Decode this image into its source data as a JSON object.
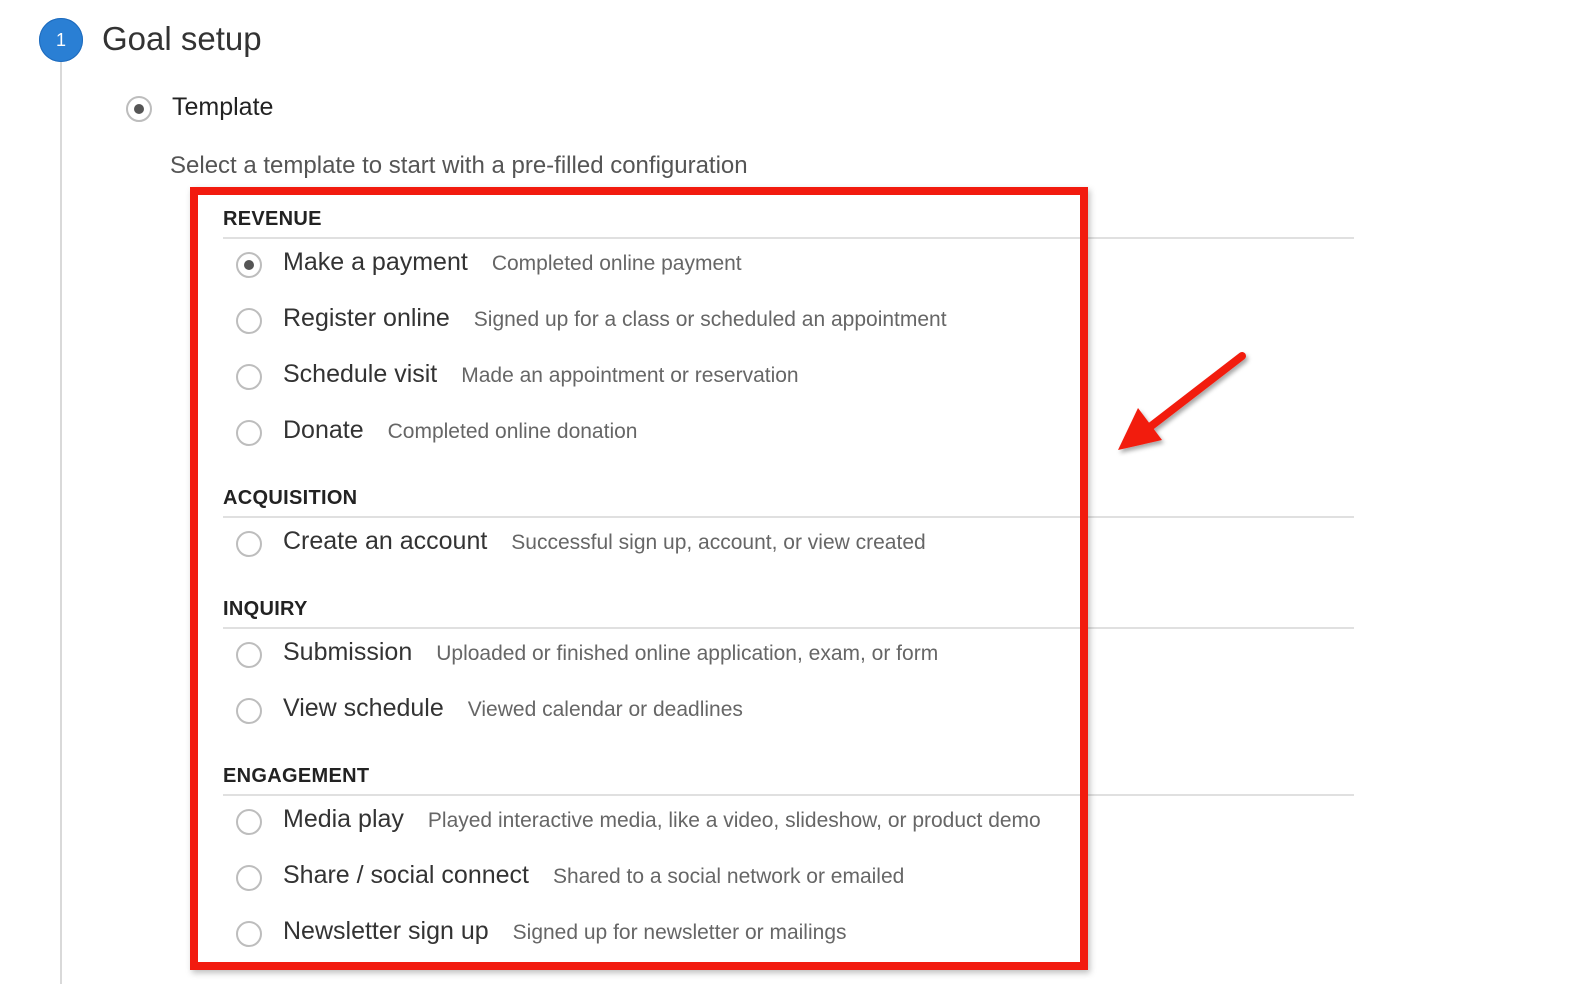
{
  "step": {
    "number": "1",
    "title": "Goal setup"
  },
  "template_option": {
    "label": "Template",
    "checked": true,
    "description": "Select a template to start with a pre-filled configuration"
  },
  "sections": [
    {
      "title": "REVENUE",
      "options": [
        {
          "label": "Make a payment",
          "description": "Completed online payment",
          "checked": true
        },
        {
          "label": "Register online",
          "description": "Signed up for a class or scheduled an appointment",
          "checked": false
        },
        {
          "label": "Schedule visit",
          "description": "Made an appointment or reservation",
          "checked": false
        },
        {
          "label": "Donate",
          "description": "Completed online donation",
          "checked": false
        }
      ]
    },
    {
      "title": "ACQUISITION",
      "options": [
        {
          "label": "Create an account",
          "description": "Successful sign up, account, or view created",
          "checked": false
        }
      ]
    },
    {
      "title": "INQUIRY",
      "options": [
        {
          "label": "Submission",
          "description": "Uploaded or finished online application, exam, or form",
          "checked": false
        },
        {
          "label": "View schedule",
          "description": "Viewed calendar or deadlines",
          "checked": false
        }
      ]
    },
    {
      "title": "ENGAGEMENT",
      "options": [
        {
          "label": "Media play",
          "description": "Played interactive media, like a video, slideshow, or product demo",
          "checked": false
        },
        {
          "label": "Share / social connect",
          "description": "Shared to a social network or emailed",
          "checked": false
        },
        {
          "label": "Newsletter sign up",
          "description": "Signed up for newsletter or mailings",
          "checked": false
        }
      ]
    }
  ],
  "colors": {
    "accent": "#2a7fd4",
    "highlight": "#f21b0f"
  }
}
